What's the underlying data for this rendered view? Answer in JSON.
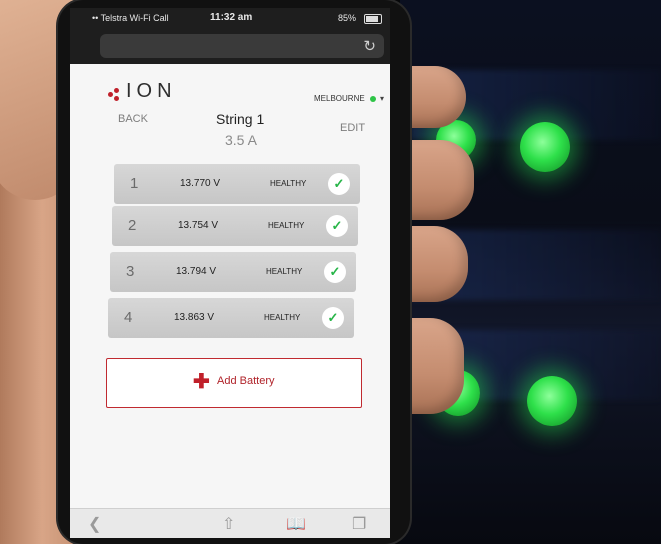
{
  "statusbar": {
    "carrier": "•• Telstra Wi-Fi Call",
    "time": "11:32 am",
    "battery": "85%"
  },
  "app": {
    "brand": "ION",
    "location": "MELBOURNE",
    "location_status_color": "#2ec447",
    "brand_color": "#c0202a"
  },
  "nav": {
    "back": "BACK",
    "title": "String 1",
    "current": "3.5 A",
    "edit": "EDIT"
  },
  "batteries": [
    {
      "number": "1",
      "voltage": "13.770 V",
      "status": "HEALTHY"
    },
    {
      "number": "2",
      "voltage": "13.754 V",
      "status": "HEALTHY"
    },
    {
      "number": "3",
      "voltage": "13.794 V",
      "status": "HEALTHY"
    },
    {
      "number": "4",
      "voltage": "13.863 V",
      "status": "HEALTHY"
    }
  ],
  "actions": {
    "add_battery": "Add Battery"
  },
  "browser_toolbar": {
    "icons": [
      "back-icon",
      "share-icon",
      "bookmarks-icon",
      "tabs-icon"
    ]
  }
}
